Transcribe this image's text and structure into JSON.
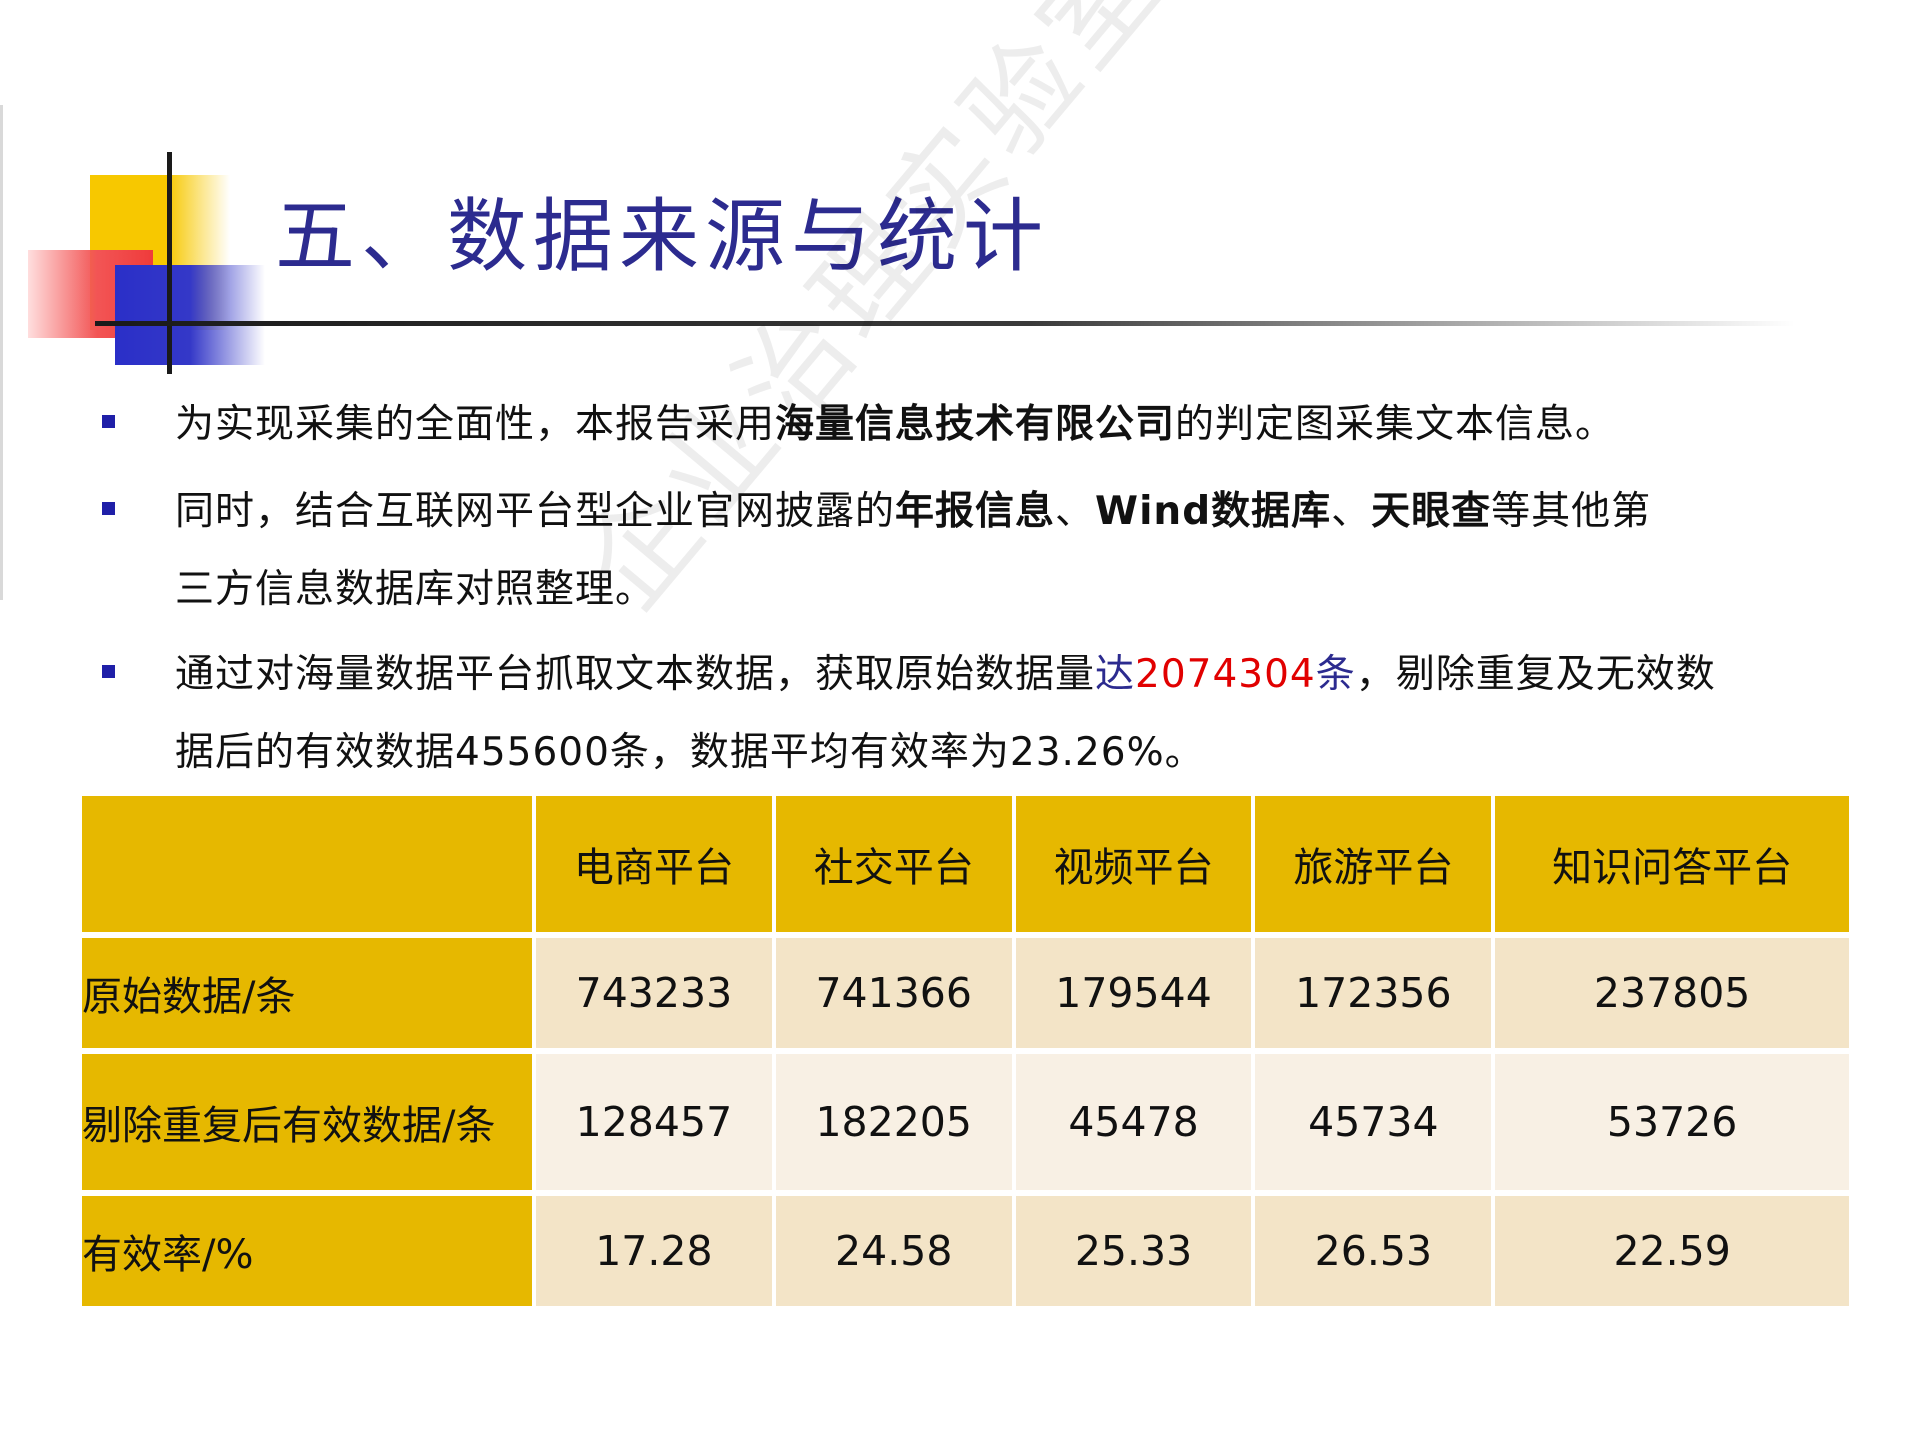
{
  "title": "五、数据来源与统计",
  "watermark": "企业治理实验室",
  "bullets": {
    "b1": {
      "pre": "为实现采集的全面性，本报告采用",
      "bold": "海量信息技术有限公司",
      "post": "的判定图采集文本信息。"
    },
    "b2": {
      "pre": "同时，结合互联网平台型企业官网披露的",
      "bold1": "年报信息",
      "sep1": "、",
      "bold2": "Wind数据库",
      "sep2": "、",
      "bold3": "天眼查",
      "post": "等其他第",
      "line2": "三方信息数据库对照整理。"
    },
    "b3": {
      "pre": "通过对海量数据平台抓取文本数据，获取原始数据量",
      "hl_a": "达",
      "red": "2074304",
      "hl_b": "条",
      "post": "，剔除重复及无效数",
      "line2_pre": "据后的有效数据",
      "line2_num1": "455600",
      "line2_mid": "条，数据平均有效率为",
      "line2_num2": "23.26%",
      "line2_end": "。"
    }
  },
  "table": {
    "headers": [
      "",
      "电商平台",
      "社交平台",
      "视频平台",
      "旅游平台",
      "知识问答平台"
    ],
    "rows": [
      {
        "label": "原始数据/条",
        "values": [
          "743233",
          "741366",
          "179544",
          "172356",
          "237805"
        ]
      },
      {
        "label": "剔除重复后有效数据/条",
        "values": [
          "128457",
          "182205",
          "45478",
          "45734",
          "53726"
        ]
      },
      {
        "label": "有效率/%",
        "values": [
          "17.28",
          "24.58",
          "25.33",
          "26.53",
          "22.59"
        ]
      }
    ]
  },
  "colors": {
    "title": "#2c2b8f",
    "bullet": "#1f1fa8",
    "highlight_red": "#e10000",
    "table_header": "#e6b800",
    "row_light": "#f3e4c7",
    "row_lighter": "#f8f0e4"
  }
}
